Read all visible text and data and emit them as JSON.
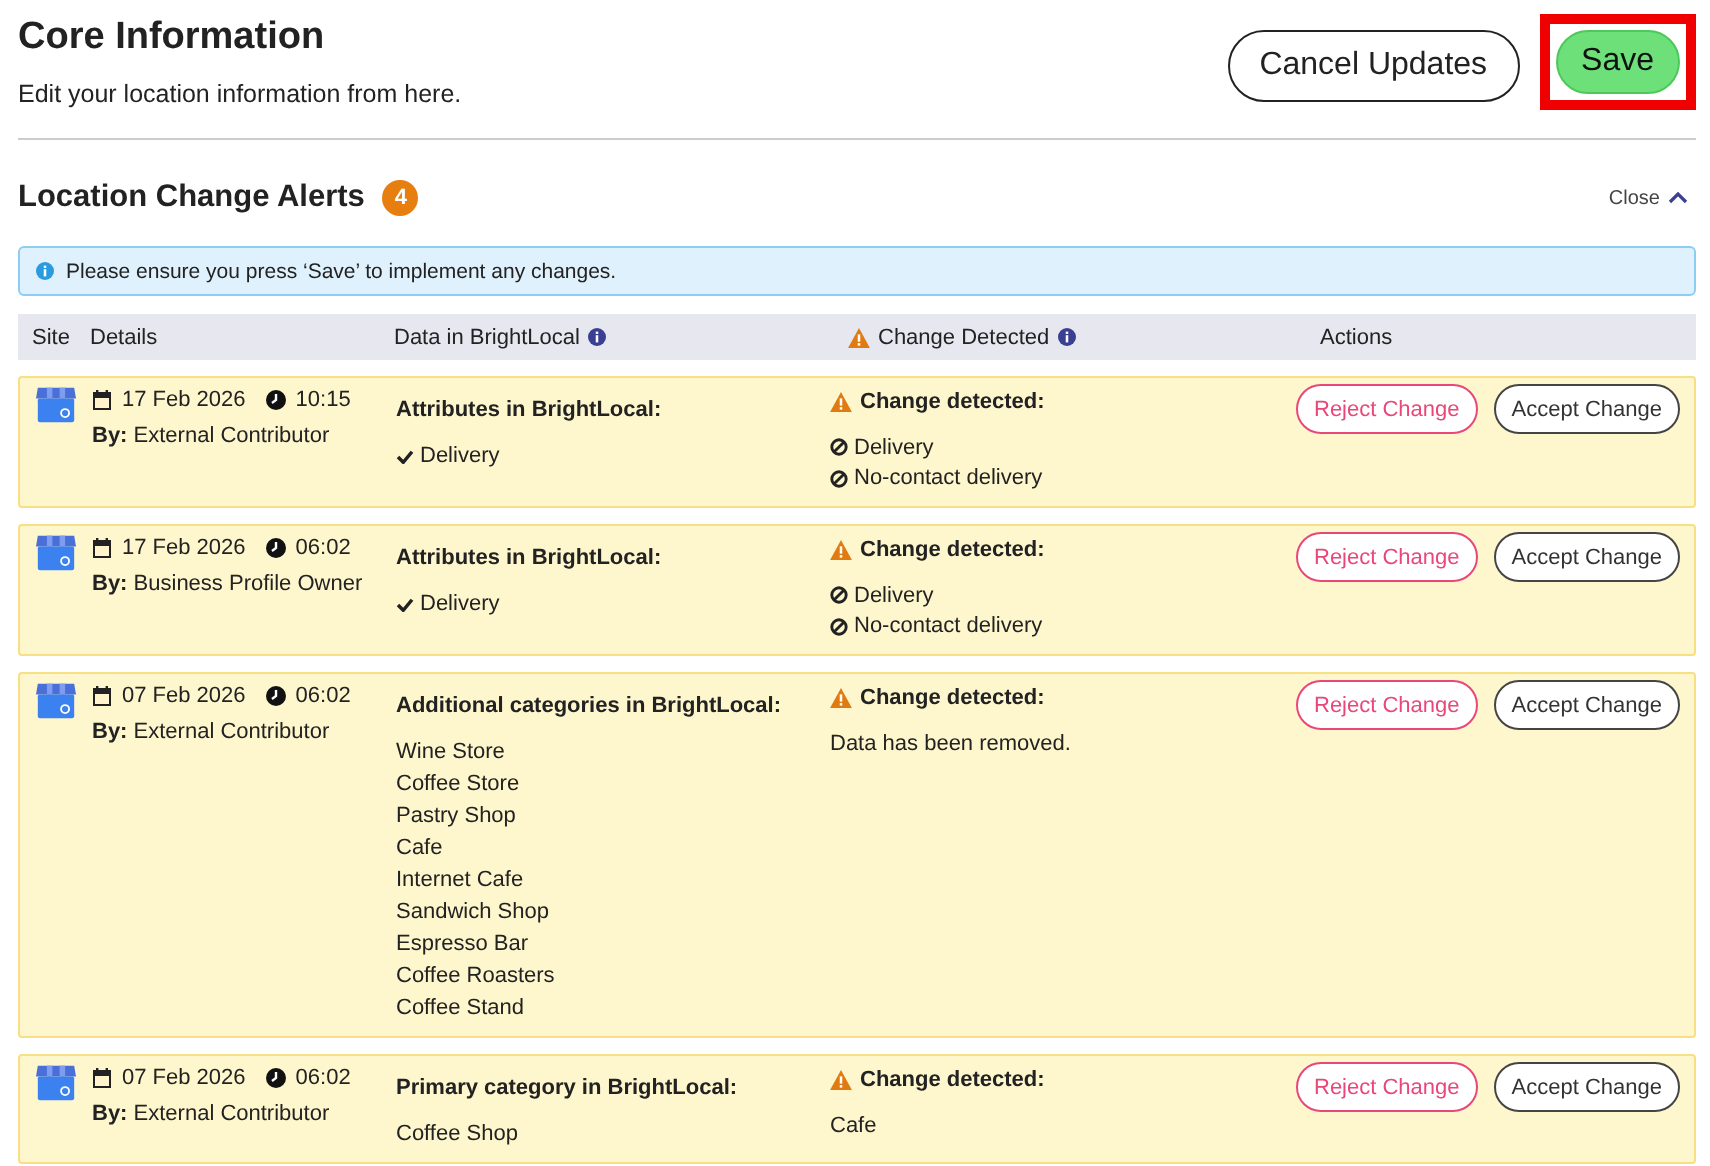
{
  "header": {
    "title": "Core Information",
    "subtitle": "Edit your location information from here.",
    "buttons": [
      {
        "label": "Cancel Updates",
        "kind": "secondary",
        "highlighted": false
      },
      {
        "label": "Save",
        "kind": "primary",
        "highlighted": true
      }
    ]
  },
  "alerts": {
    "title": "Location Change Alerts",
    "count": "4",
    "close_label": "Close",
    "expanded": true,
    "notice": "Please ensure you press ‘Save’ to implement any changes.",
    "columns": [
      {
        "label": "Site"
      },
      {
        "label": "Details"
      },
      {
        "label": "Data in BrightLocal",
        "info": true
      },
      {
        "label": "Change Detected",
        "info": true,
        "warning": true
      },
      {
        "label": "Actions"
      }
    ],
    "rows": [
      {
        "date": "17 Feb 2026",
        "time": "10:15",
        "by_label": "By:",
        "by": "External Contributor",
        "data_title": "Attributes in BrightLocal:",
        "data_items": [
          {
            "text": "Delivery",
            "kind": "check"
          }
        ],
        "change_title": "Change detected:",
        "change_items": [
          {
            "text": "Delivery",
            "kind": "blocked"
          },
          {
            "text": "No-contact delivery",
            "kind": "blocked"
          }
        ],
        "actions": [
          "Reject Change",
          "Accept Change"
        ]
      },
      {
        "date": "17 Feb 2026",
        "time": "06:02",
        "by_label": "By:",
        "by": "Business Profile Owner",
        "data_title": "Attributes in BrightLocal:",
        "data_items": [
          {
            "text": "Delivery",
            "kind": "check"
          }
        ],
        "change_title": "Change detected:",
        "change_items": [
          {
            "text": "Delivery",
            "kind": "blocked"
          },
          {
            "text": "No-contact delivery",
            "kind": "blocked"
          }
        ],
        "actions": [
          "Reject Change",
          "Accept Change"
        ]
      },
      {
        "date": "07 Feb 2026",
        "time": "06:02",
        "by_label": "By:",
        "by": "External Contributor",
        "data_title": "Additional categories in BrightLocal:",
        "data_items": [
          {
            "text": "Wine Store",
            "kind": "plain"
          },
          {
            "text": "Coffee Store",
            "kind": "plain"
          },
          {
            "text": "Pastry Shop",
            "kind": "plain"
          },
          {
            "text": "Cafe",
            "kind": "plain"
          },
          {
            "text": "Internet Cafe",
            "kind": "plain"
          },
          {
            "text": "Sandwich Shop",
            "kind": "plain"
          },
          {
            "text": "Espresso Bar",
            "kind": "plain"
          },
          {
            "text": "Coffee Roasters",
            "kind": "plain"
          },
          {
            "text": "Coffee Stand",
            "kind": "plain"
          }
        ],
        "change_title": "Change detected:",
        "change_items": [
          {
            "text": "Data has been removed.",
            "kind": "plain"
          }
        ],
        "actions": [
          "Reject Change",
          "Accept Change"
        ]
      },
      {
        "date": "07 Feb 2026",
        "time": "06:02",
        "by_label": "By:",
        "by": "External Contributor",
        "data_title": "Primary category in BrightLocal:",
        "data_items": [
          {
            "text": "Coffee Shop",
            "kind": "plain"
          }
        ],
        "change_title": "Change detected:",
        "change_items": [
          {
            "text": "Cafe",
            "kind": "plain"
          }
        ],
        "actions": [
          "Reject Change",
          "Accept Change"
        ]
      }
    ]
  }
}
